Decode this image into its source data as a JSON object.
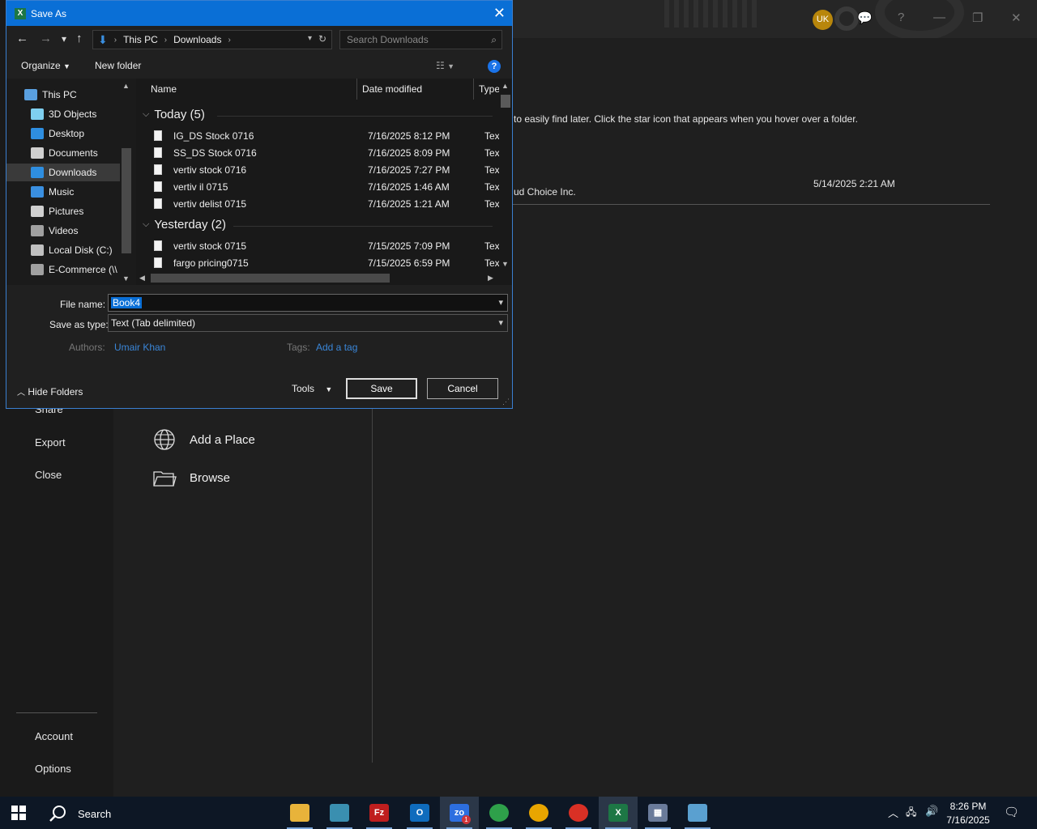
{
  "dialog": {
    "title": "Save As",
    "close": "✕",
    "nav": {
      "back": "←",
      "forward": "→",
      "recent": "▾",
      "up": "↑",
      "refresh": "↻",
      "path": [
        "This PC",
        "Downloads"
      ],
      "search_placeholder": "Search Downloads"
    },
    "toolbar": {
      "organize": "Organize",
      "new_folder": "New folder",
      "help": "?"
    },
    "tree": [
      {
        "label": "This PC",
        "icon": "this-pc-icon"
      },
      {
        "label": "3D Objects",
        "icon": "3d-objects-icon"
      },
      {
        "label": "Desktop",
        "icon": "desktop-icon"
      },
      {
        "label": "Documents",
        "icon": "documents-icon"
      },
      {
        "label": "Downloads",
        "icon": "downloads-icon",
        "selected": true
      },
      {
        "label": "Music",
        "icon": "music-icon"
      },
      {
        "label": "Pictures",
        "icon": "pictures-icon"
      },
      {
        "label": "Videos",
        "icon": "videos-icon"
      },
      {
        "label": "Local Disk (C:)",
        "icon": "local-disk-icon"
      },
      {
        "label": "E-Commerce (\\\\",
        "icon": "network-drive-icon"
      }
    ],
    "columns": {
      "name": "Name",
      "date": "Date modified",
      "type": "Type"
    },
    "groups": [
      {
        "label": "Today (5)",
        "files": [
          {
            "name": "IG_DS Stock 0716",
            "date": "7/16/2025 8:12 PM",
            "type": "Text"
          },
          {
            "name": "SS_DS Stock 0716",
            "date": "7/16/2025 8:09 PM",
            "type": "Text"
          },
          {
            "name": "vertiv stock 0716",
            "date": "7/16/2025 7:27 PM",
            "type": "Text"
          },
          {
            "name": "vertiv il 0715",
            "date": "7/16/2025 1:46 AM",
            "type": "Text"
          },
          {
            "name": "vertiv delist 0715",
            "date": "7/16/2025 1:21 AM",
            "type": "Text"
          }
        ]
      },
      {
        "label": "Yesterday (2)",
        "files": [
          {
            "name": "vertiv stock 0715",
            "date": "7/15/2025 7:09 PM",
            "type": "Text"
          },
          {
            "name": "fargo pricing0715",
            "date": "7/15/2025 6:59 PM",
            "type": "Text"
          }
        ]
      }
    ],
    "form": {
      "file_name_label": "File name:",
      "file_name_value": "Book4",
      "save_type_label": "Save as type:",
      "save_type_value": "Text (Tab delimited)",
      "authors_label": "Authors:",
      "authors_value": "Umair Khan",
      "tags_label": "Tags:",
      "tags_value": "Add a tag"
    },
    "footer": {
      "hide_folders": "Hide Folders",
      "tools": "Tools",
      "save": "Save",
      "cancel": "Cancel"
    }
  },
  "excel": {
    "avatar_initials": "UK",
    "hint_text": "to easily find later. Click the star icon that appears when you hover over a folder.",
    "recent_item_name": "ud Choice Inc.",
    "recent_item_date": "5/14/2025 2:21 AM",
    "sidebar": {
      "share": "Share",
      "export": "Export",
      "close": "Close",
      "account": "Account",
      "options": "Options"
    },
    "places": {
      "add_place": "Add a Place",
      "browse": "Browse"
    },
    "window_controls": {
      "help": "?",
      "minimize": "—",
      "restore": "❐",
      "close": "✕"
    }
  },
  "taskbar": {
    "search_label": "Search",
    "apps": [
      {
        "name": "file-explorer",
        "glyph": "",
        "color": "#e8b33a"
      },
      {
        "name": "app-diamond",
        "glyph": "",
        "color": "#3a8fb0"
      },
      {
        "name": "filezilla",
        "glyph": "Fz",
        "color": "#bf1e1e"
      },
      {
        "name": "outlook",
        "glyph": "O",
        "color": "#0f6cbd"
      },
      {
        "name": "zoom",
        "glyph": "zo",
        "color": "#2d6fe0",
        "badge": "1",
        "active": true
      },
      {
        "name": "chrome-1",
        "glyph": "",
        "color": "#2ea04a"
      },
      {
        "name": "chrome-2",
        "glyph": "",
        "color": "#e8a500"
      },
      {
        "name": "chrome-3",
        "glyph": "",
        "color": "#d93025"
      },
      {
        "name": "excel",
        "glyph": "X",
        "color": "#1d7745",
        "active": true
      },
      {
        "name": "calculator",
        "glyph": "▦",
        "color": "#6a7b9a"
      },
      {
        "name": "app-notes",
        "glyph": "",
        "color": "#5aa0d0"
      }
    ],
    "time": "8:26 PM",
    "date": "7/16/2025"
  }
}
